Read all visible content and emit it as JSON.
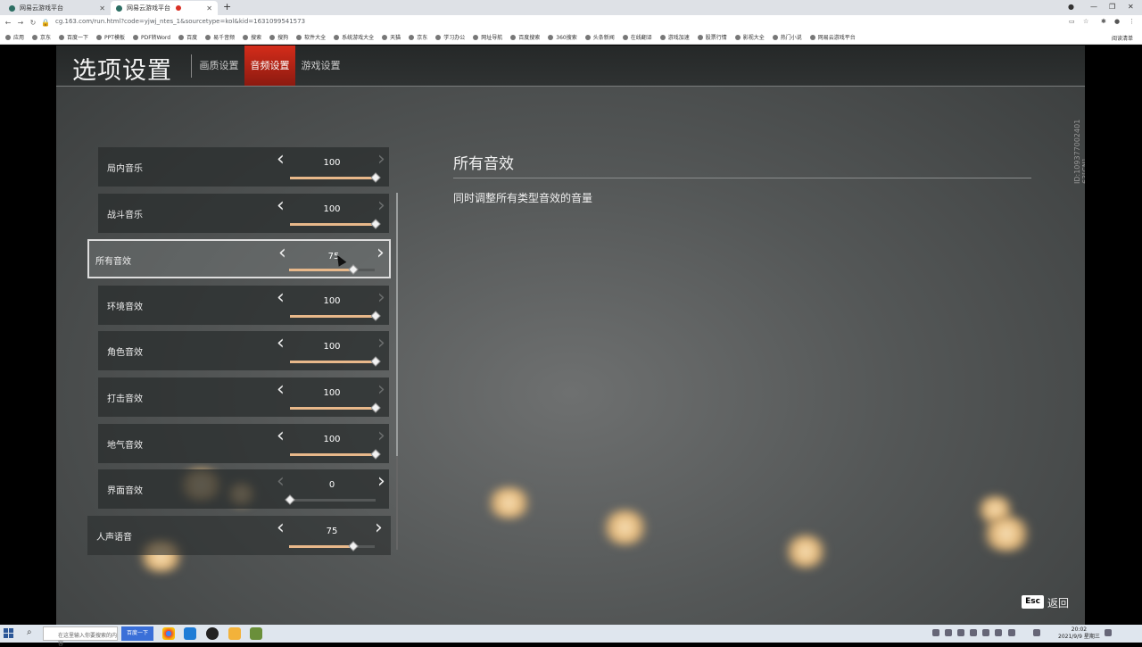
{
  "browser": {
    "tabs": [
      {
        "label": "网易云游戏平台",
        "active": false
      },
      {
        "label": "网易云游戏平台",
        "active": true
      }
    ],
    "url": "cg.163.com/run.html?code=yjwj_ntes_1&sourcetype=kol&kid=1631099541573",
    "bookmarks": [
      "应用",
      "京东",
      "百度一下",
      "PPT模板",
      "PDF转Word",
      "百度",
      "易千音频",
      "搜索",
      "搜狗",
      "软件大全",
      "系统游戏大全",
      "天猫",
      "京东",
      "学习办公",
      "网址导航",
      "百度搜索",
      "360搜索",
      "头条新闻",
      "在线翻译",
      "游戏加速",
      "股票行情",
      "影视大全",
      "热门小说",
      "网易云游戏平台"
    ],
    "reading_list": "阅读清单"
  },
  "game": {
    "page_title": "选项设置",
    "tabs": [
      {
        "label": "画质设置",
        "active": false
      },
      {
        "label": "音频设置",
        "active": true
      },
      {
        "label": "游戏设置",
        "active": false
      }
    ],
    "side_id": "ID:109377002401 63[CN]",
    "settings": [
      {
        "label": "局内音乐",
        "value": 100,
        "fraction": 1.0,
        "selected": false,
        "left_enabled": true,
        "right_enabled": false
      },
      {
        "label": "战斗音乐",
        "value": 100,
        "fraction": 1.0,
        "selected": false,
        "left_enabled": true,
        "right_enabled": false
      },
      {
        "label": "所有音效",
        "value": 75,
        "fraction": 0.75,
        "selected": true,
        "left_enabled": true,
        "right_enabled": true
      },
      {
        "label": "环境音效",
        "value": 100,
        "fraction": 1.0,
        "selected": false,
        "left_enabled": true,
        "right_enabled": false
      },
      {
        "label": "角色音效",
        "value": 100,
        "fraction": 1.0,
        "selected": false,
        "left_enabled": true,
        "right_enabled": false
      },
      {
        "label": "打击音效",
        "value": 100,
        "fraction": 1.0,
        "selected": false,
        "left_enabled": true,
        "right_enabled": false
      },
      {
        "label": "地气音效",
        "value": 100,
        "fraction": 1.0,
        "selected": false,
        "left_enabled": true,
        "right_enabled": false
      },
      {
        "label": "界面音效",
        "value": 0,
        "fraction": 0.0,
        "selected": false,
        "left_enabled": false,
        "right_enabled": true
      },
      {
        "label": "人声语音",
        "value": 75,
        "fraction": 0.75,
        "selected": false,
        "left_enabled": true,
        "right_enabled": true
      }
    ],
    "description": {
      "title": "所有音效",
      "text": "同时调整所有类型音效的音量"
    },
    "esc_key": "Esc",
    "back_label": "返回",
    "colors": {
      "accent": "#d42c1a",
      "slider_fill": "#e8b88a"
    }
  },
  "taskbar": {
    "search_placeholder": "在这里输入你要搜索的内容",
    "search_button": "百度一下",
    "time": "20:02",
    "date": "2021/9/9 星期三"
  }
}
